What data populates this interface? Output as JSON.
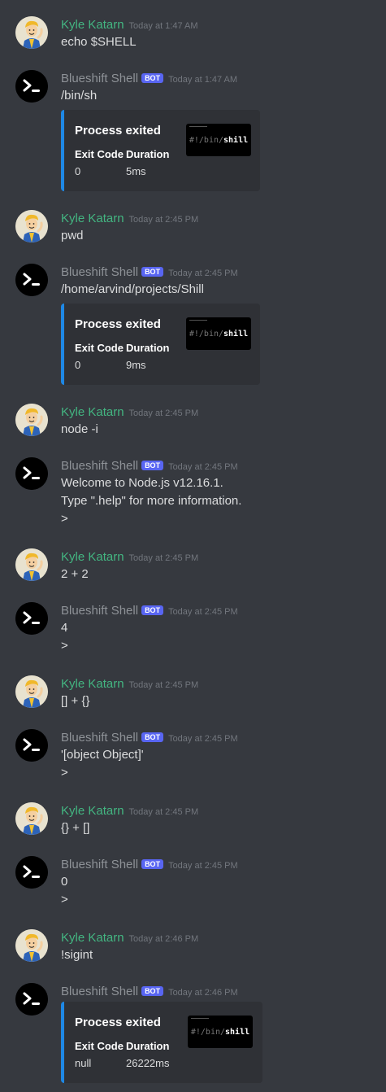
{
  "users": {
    "kyle": {
      "name": "Kyle Katarn"
    },
    "bot": {
      "name": "Blueshift Shell",
      "badge": "BOT"
    }
  },
  "embed_labels": {
    "title": "Process exited",
    "exit_code": "Exit Code",
    "duration": "Duration"
  },
  "thumb_text": {
    "prefix": "#!/bin/",
    "suffix": "shill"
  },
  "messages": [
    {
      "author": "kyle",
      "time": "Today at 1:47 AM",
      "lines": [
        "echo $SHELL"
      ]
    },
    {
      "author": "bot",
      "time": "Today at 1:47 AM",
      "lines": [
        "/bin/sh"
      ],
      "embed": {
        "exit_code": "0",
        "duration": "5ms"
      }
    },
    {
      "author": "kyle",
      "time": "Today at 2:45 PM",
      "lines": [
        "pwd"
      ]
    },
    {
      "author": "bot",
      "time": "Today at 2:45 PM",
      "lines": [
        "/home/arvind/projects/Shill"
      ],
      "embed": {
        "exit_code": "0",
        "duration": "9ms"
      }
    },
    {
      "author": "kyle",
      "time": "Today at 2:45 PM",
      "lines": [
        "node -i"
      ]
    },
    {
      "author": "bot",
      "time": "Today at 2:45 PM",
      "lines": [
        "Welcome to Node.js v12.16.1.",
        "Type \".help\" for more information.",
        ">"
      ]
    },
    {
      "author": "kyle",
      "time": "Today at 2:45 PM",
      "lines": [
        "2 + 2"
      ]
    },
    {
      "author": "bot",
      "time": "Today at 2:45 PM",
      "lines": [
        "4",
        ">"
      ]
    },
    {
      "author": "kyle",
      "time": "Today at 2:45 PM",
      "lines": [
        "[] + {}"
      ]
    },
    {
      "author": "bot",
      "time": "Today at 2:45 PM",
      "lines": [
        "'[object Object]'",
        ">"
      ]
    },
    {
      "author": "kyle",
      "time": "Today at 2:45 PM",
      "lines": [
        "{} + []"
      ]
    },
    {
      "author": "bot",
      "time": "Today at 2:45 PM",
      "lines": [
        "0",
        ">"
      ]
    },
    {
      "author": "kyle",
      "time": "Today at 2:46 PM",
      "lines": [
        "!sigint"
      ]
    },
    {
      "author": "bot",
      "time": "Today at 2:46 PM",
      "lines": [],
      "embed": {
        "exit_code": "null",
        "duration": "26222ms"
      }
    }
  ]
}
